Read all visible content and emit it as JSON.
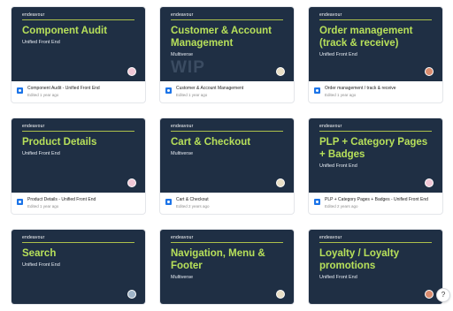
{
  "brand": "endeavour",
  "cards": [
    {
      "title": "Component Audit",
      "subtitle": "Unified Front End",
      "file_name": "Component Audit - Unified Front End",
      "edited": "Edited 1 year ago"
    },
    {
      "title": "Customer & Account Management",
      "subtitle": "Multiverse",
      "watermark": "WIP",
      "file_name": "Customer & Account Management",
      "edited": "Edited 1 year ago"
    },
    {
      "title": "Order management (track & receive)",
      "subtitle": "Unified Front End",
      "file_name": "Order management / track & receive",
      "edited": "Edited 1 year ago"
    },
    {
      "title": "Product Details",
      "subtitle": "Unified Front End",
      "file_name": "Product Details - Unified Front End",
      "edited": "Edited 1 year ago"
    },
    {
      "title": "Cart & Checkout",
      "subtitle": "Multiverse",
      "file_name": "Cart & Checkout",
      "edited": "Edited 2 years ago"
    },
    {
      "title": "PLP + Category Pages + Badges",
      "subtitle": "Unified Front End",
      "file_name": "PLP + Category Pages + Badges - Unified Front End",
      "edited": "Edited 2 years ago"
    },
    {
      "title": "Search",
      "subtitle": "Unified Front End"
    },
    {
      "title": "Navigation, Menu & Footer",
      "subtitle": "Multiverse"
    },
    {
      "title": "Loyalty / Loyalty promotions",
      "subtitle": "Unified Front End"
    }
  ],
  "help_label": "?"
}
